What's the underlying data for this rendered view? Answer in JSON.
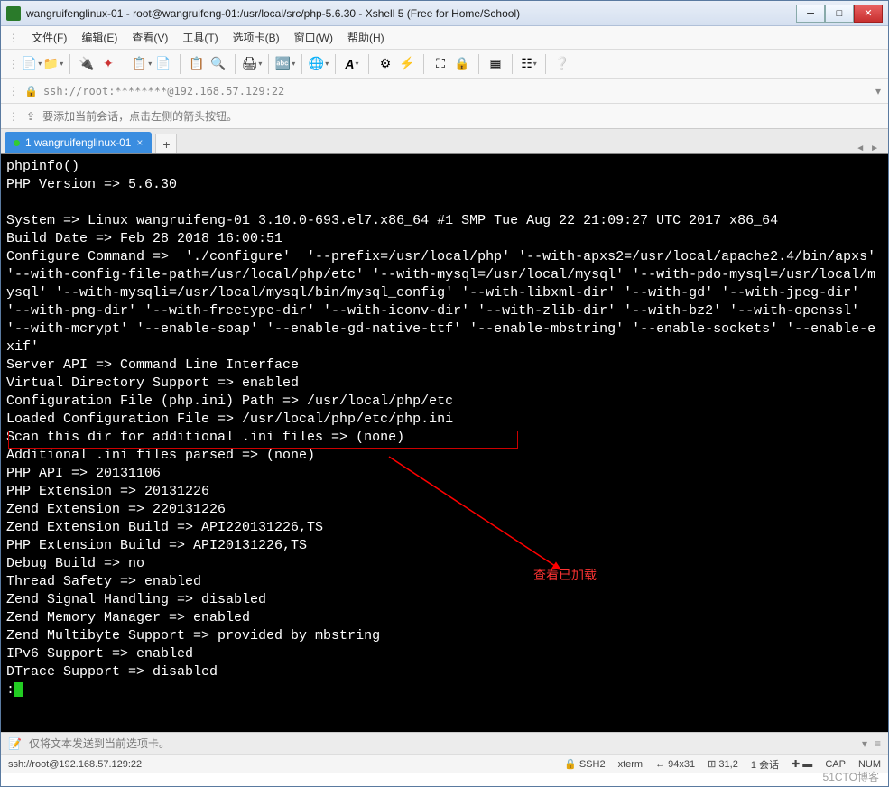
{
  "window": {
    "title": "wangruifenglinux-01 - root@wangruifeng-01:/usr/local/src/php-5.6.30 - Xshell 5 (Free for Home/School)"
  },
  "menus": {
    "file": "文件(F)",
    "edit": "编辑(E)",
    "view": "查看(V)",
    "tools": "工具(T)",
    "tabs": "选项卡(B)",
    "window": "窗口(W)",
    "help": "帮助(H)"
  },
  "address": {
    "url": "ssh://root:********@192.168.57.129:22"
  },
  "info": {
    "text": "要添加当前会话，点击左侧的箭头按钮。"
  },
  "tab": {
    "label": "1 wangruifenglinux-01"
  },
  "terminal": {
    "lines": [
      "phpinfo()",
      "PHP Version => 5.6.30",
      "",
      "System => Linux wangruifeng-01 3.10.0-693.el7.x86_64 #1 SMP Tue Aug 22 21:09:27 UTC 2017 x86_64",
      "Build Date => Feb 28 2018 16:00:51",
      "Configure Command =>  './configure'  '--prefix=/usr/local/php' '--with-apxs2=/usr/local/apache2.4/bin/apxs' '--with-config-file-path=/usr/local/php/etc' '--with-mysql=/usr/local/mysql' '--with-pdo-mysql=/usr/local/mysql' '--with-mysqli=/usr/local/mysql/bin/mysql_config' '--with-libxml-dir' '--with-gd' '--with-jpeg-dir' '--with-png-dir' '--with-freetype-dir' '--with-iconv-dir' '--with-zlib-dir' '--with-bz2' '--with-openssl' '--with-mcrypt' '--enable-soap' '--enable-gd-native-ttf' '--enable-mbstring' '--enable-sockets' '--enable-exif'",
      "Server API => Command Line Interface",
      "Virtual Directory Support => enabled",
      "Configuration File (php.ini) Path => /usr/local/php/etc",
      "Loaded Configuration File => /usr/local/php/etc/php.ini",
      "Scan this dir for additional .ini files => (none)",
      "Additional .ini files parsed => (none)",
      "PHP API => 20131106",
      "PHP Extension => 20131226",
      "Zend Extension => 220131226",
      "Zend Extension Build => API220131226,TS",
      "PHP Extension Build => API20131226,TS",
      "Debug Build => no",
      "Thread Safety => enabled",
      "Zend Signal Handling => disabled",
      "Zend Memory Manager => enabled",
      "Zend Multibyte Support => provided by mbstring",
      "IPv6 Support => enabled",
      "DTrace Support => disabled"
    ],
    "prompt": ":",
    "note": "查看已加载"
  },
  "bottom": {
    "text": "仅将文本发送到当前选项卡。"
  },
  "status": {
    "conn": "ssh://root@192.168.57.129:22",
    "proto": "SSH2",
    "term": "xterm",
    "size": "94x31",
    "pos": "31,2",
    "sessions": "1 会话",
    "caps": "CAP",
    "num": "NUM"
  },
  "watermark": "51CTO博客"
}
